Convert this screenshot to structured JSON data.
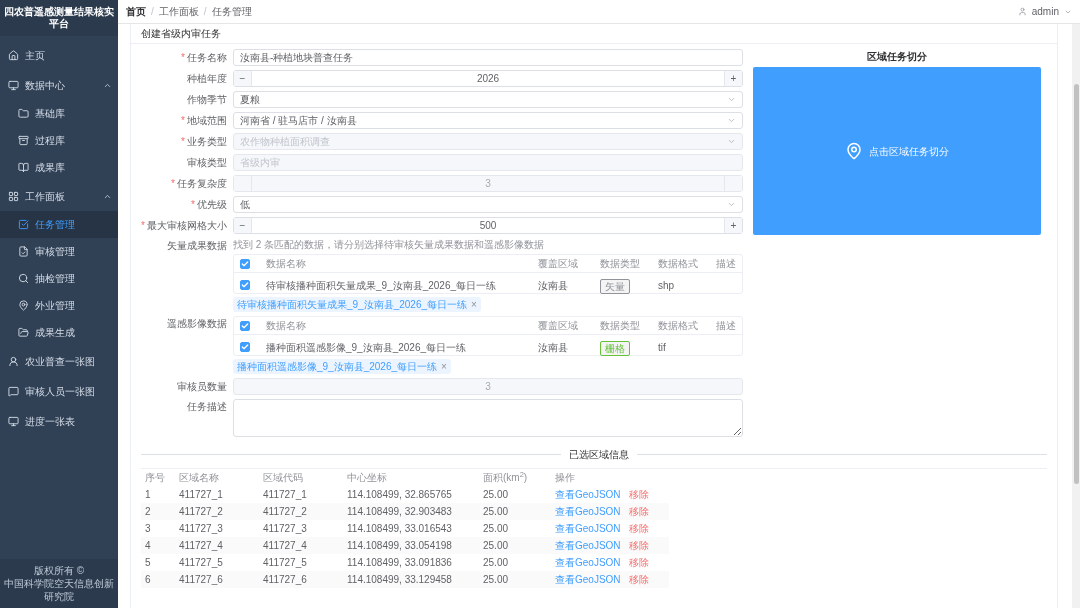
{
  "app_title": "四农普遥感测量结果核实平台",
  "sidebar": {
    "items": [
      {
        "label": "主页",
        "selected": false
      },
      {
        "label": "数据中心",
        "selected": false,
        "expanded": true,
        "children": [
          {
            "label": "基础库",
            "selected": false
          },
          {
            "label": "过程库",
            "selected": false
          },
          {
            "label": "成果库",
            "selected": false
          }
        ]
      },
      {
        "label": "工作面板",
        "selected": false,
        "expanded": true,
        "children": [
          {
            "label": "任务管理",
            "selected": true
          },
          {
            "label": "审核管理",
            "selected": false
          },
          {
            "label": "抽检管理",
            "selected": false
          },
          {
            "label": "外业管理",
            "selected": false
          },
          {
            "label": "成果生成",
            "selected": false
          }
        ]
      },
      {
        "label": "农业普查一张图",
        "selected": false
      },
      {
        "label": "审核人员一张图",
        "selected": false
      },
      {
        "label": "进度一张表",
        "selected": false
      }
    ],
    "footer": [
      "版权所有 ©",
      "中国科学院空天信息创新研究院"
    ]
  },
  "breadcrumb": {
    "separator": "/",
    "items": [
      "首页",
      "工作面板",
      "任务管理"
    ]
  },
  "user": "admin",
  "card_title": "创建省级内审任务",
  "required_mark": "*",
  "form": [
    {
      "kind": "input",
      "label": "任务名称",
      "required": true,
      "value": "汝南县-种植地块普查任务",
      "disabled": false
    },
    {
      "kind": "number",
      "label": "种植年度",
      "required": false,
      "value": "2026",
      "disabled": false,
      "minus": "−",
      "plus": "+"
    },
    {
      "kind": "select",
      "label": "作物季节",
      "required": false,
      "value": "夏粮",
      "disabled": false
    },
    {
      "kind": "select",
      "label": "地域范围",
      "required": true,
      "value": "河南省 / 驻马店市 / 汝南县",
      "disabled": false
    },
    {
      "kind": "select",
      "label": "业务类型",
      "required": true,
      "placeholder": "农作物种植面积调查",
      "disabled": true
    },
    {
      "kind": "input",
      "label": "审核类型",
      "required": false,
      "placeholder": "省级内审",
      "disabled": true
    },
    {
      "kind": "number",
      "label": "任务复杂度",
      "required": true,
      "value": "3",
      "disabled": true
    },
    {
      "kind": "select",
      "label": "优先级",
      "required": true,
      "value": "低",
      "disabled": false
    },
    {
      "kind": "number",
      "label": "最大审核网格大小",
      "required": true,
      "value": "500",
      "disabled": false,
      "minus": "−",
      "plus": "+"
    }
  ],
  "data_sections": [
    {
      "label": "矢量成果数据",
      "hint": "找到 2 条匹配的数据，请分别选择待审核矢量成果数据和遥感影像数据",
      "header_checked": true,
      "columns": [
        "数据名称",
        "覆盖区域",
        "数据类型",
        "数据格式",
        "描述"
      ],
      "rows": [
        {
          "checked": true,
          "name": "待审核播种面积矢量成果_9_汝南县_2026_每日一练",
          "area": "汝南县",
          "type": "矢量",
          "color": "#909399",
          "format": "shp"
        }
      ],
      "chip": "待审核播种面积矢量成果_9_汝南县_2026_每日一练",
      "chip_close": "×"
    },
    {
      "label": "遥感影像数据",
      "header_checked": true,
      "columns": [
        "数据名称",
        "覆盖区域",
        "数据类型",
        "数据格式",
        "描述"
      ],
      "rows": [
        {
          "checked": true,
          "name": "播种面积遥感影像_9_汝南县_2026_每日一练",
          "area": "汝南县",
          "type": "栅格",
          "color": "#67c23a",
          "format": "tif"
        }
      ],
      "chip": "播种面积遥感影像_9_汝南县_2026_每日一练",
      "chip_close": "×"
    }
  ],
  "reviewer_count": {
    "label": "审核员数量",
    "value": "3",
    "disabled": true
  },
  "description": {
    "label": "任务描述"
  },
  "split_panel": {
    "title": "区域任务切分",
    "button": "点击区域任务切分"
  },
  "regions": {
    "title": "已选区域信息",
    "columns": [
      "序号",
      "区域名称",
      "区域代码",
      "中心坐标",
      "面积(km$^{2}$)",
      "操作"
    ],
    "rows": [
      {
        "index": "1",
        "name": "411727_1",
        "code": "411727_1",
        "center": "114.108499, 32.865765",
        "area": "25.00",
        "view": "查看GeoJSON",
        "remove": "移除"
      },
      {
        "index": "2",
        "name": "411727_2",
        "code": "411727_2",
        "center": "114.108499, 32.903483",
        "area": "25.00",
        "view": "查看GeoJSON",
        "remove": "移除"
      },
      {
        "index": "3",
        "name": "411727_3",
        "code": "411727_3",
        "center": "114.108499, 33.016543",
        "area": "25.00",
        "view": "查看GeoJSON",
        "remove": "移除"
      },
      {
        "index": "4",
        "name": "411727_4",
        "code": "411727_4",
        "center": "114.108499, 33.054198",
        "area": "25.00",
        "view": "查看GeoJSON",
        "remove": "移除"
      },
      {
        "index": "5",
        "name": "411727_5",
        "code": "411727_5",
        "center": "114.108499, 33.091836",
        "area": "25.00",
        "view": "查看GeoJSON",
        "remove": "移除"
      },
      {
        "index": "6",
        "name": "411727_6",
        "code": "411727_6",
        "center": "114.108499, 33.129458",
        "area": "25.00",
        "view": "查看GeoJSON",
        "remove": "移除"
      }
    ]
  }
}
